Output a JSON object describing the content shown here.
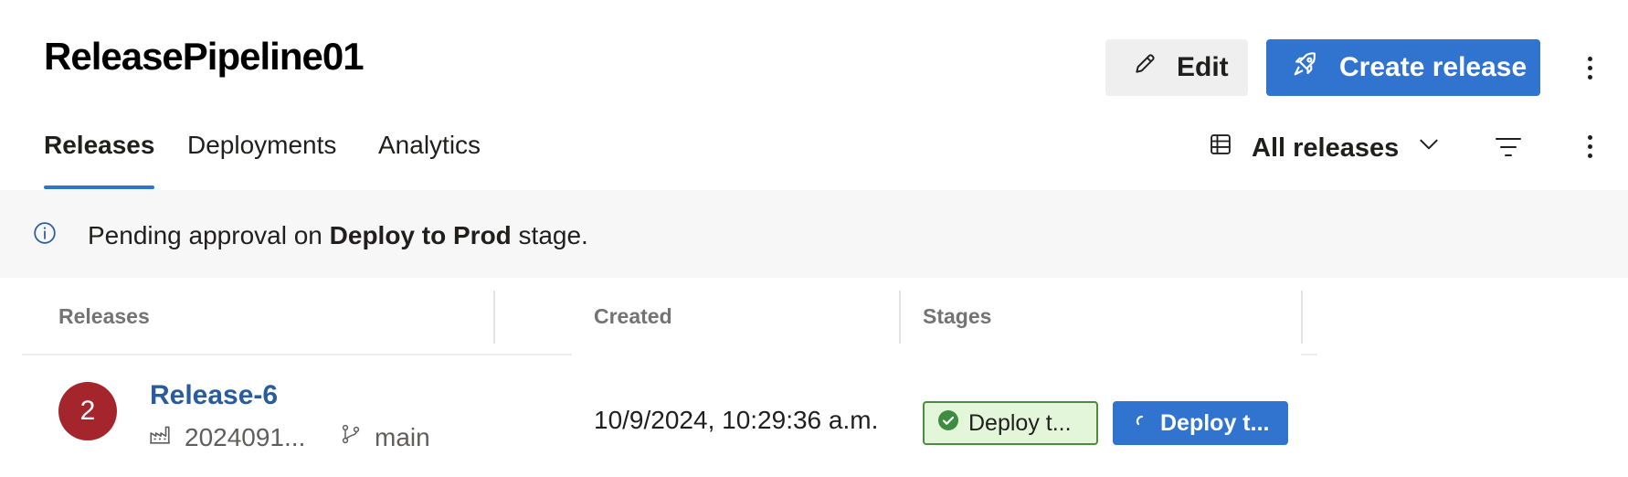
{
  "header": {
    "title": "ReleasePipeline01",
    "edit_label": "Edit",
    "create_label": "Create release"
  },
  "tabs": [
    {
      "label": "Releases",
      "active": true
    },
    {
      "label": "Deployments",
      "active": false
    },
    {
      "label": "Analytics",
      "active": false
    }
  ],
  "view": {
    "label": "All releases"
  },
  "banner": {
    "prefix": "Pending approval on ",
    "stage": "Deploy to Prod",
    "suffix": " stage."
  },
  "table": {
    "columns": [
      "Releases",
      "Created",
      "Stages"
    ],
    "rows": [
      {
        "avatar": "2",
        "avatar_color": "#a4262c",
        "name": "Release-6",
        "build": "2024091...",
        "branch": "main",
        "created": "10/9/2024, 10:29:36 a.m.",
        "stages": [
          {
            "label": "Deploy t...",
            "status": "succeeded",
            "color": "#e3f6da"
          },
          {
            "label": "Deploy t...",
            "status": "in-progress",
            "color": "#3174d0"
          }
        ]
      }
    ]
  },
  "icons": [
    "pencil-icon",
    "rocket-icon",
    "more-icon",
    "table-view-icon",
    "chevron-down-icon",
    "filter-icon",
    "info-icon",
    "build-icon",
    "branch-icon",
    "check-circle-icon",
    "spinner-icon"
  ],
  "colors": {
    "accent": "#3174d0",
    "link": "#2a5b9c",
    "success": "#4d8c3b"
  }
}
